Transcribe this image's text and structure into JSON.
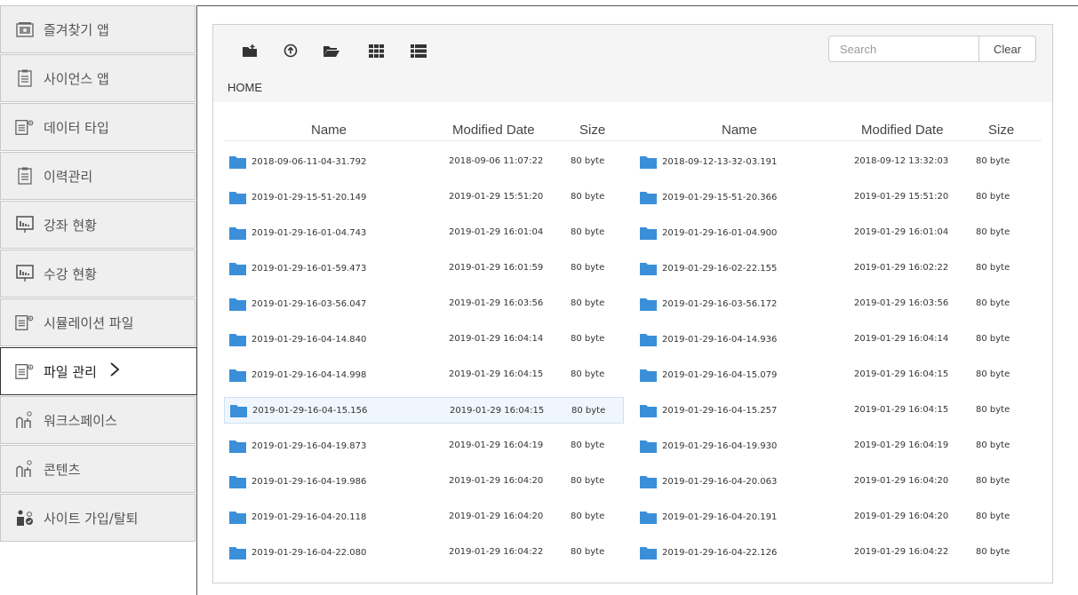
{
  "sidebar": {
    "items": [
      {
        "label": "즐겨찾기 앱",
        "icon": "favorites-app-icon"
      },
      {
        "label": "사이언스 앱",
        "icon": "document-icon"
      },
      {
        "label": "데이터 타입",
        "icon": "document-gear-icon"
      },
      {
        "label": "이력관리",
        "icon": "document-icon"
      },
      {
        "label": "강좌 현황",
        "icon": "bar-chart-icon"
      },
      {
        "label": "수강 현황",
        "icon": "bar-chart-icon"
      },
      {
        "label": "시뮬레이션 파일",
        "icon": "document-gear-icon"
      },
      {
        "label": "파일 관리",
        "icon": "document-gear-icon",
        "active": true
      },
      {
        "label": "워크스페이스",
        "icon": "workspace-icon"
      },
      {
        "label": "콘텐츠",
        "icon": "workspace-icon"
      },
      {
        "label": "사이트 가입/탈퇴",
        "icon": "user-settings-icon"
      }
    ]
  },
  "toolbar": {
    "buttons": [
      "new-folder-icon",
      "upload-icon",
      "open-folder-icon",
      "grid-view-icon",
      "list-view-icon"
    ],
    "search_placeholder": "Search",
    "clear_label": "Clear"
  },
  "breadcrumb": "HOME",
  "columns": {
    "name": "Name",
    "modified": "Modified Date",
    "size": "Size"
  },
  "files": [
    {
      "name": "2018-09-06-11-04-31.792",
      "modified": "2018-09-06 11:07:22",
      "size": "80 byte"
    },
    {
      "name": "2018-09-12-13-32-03.191",
      "modified": "2018-09-12 13:32:03",
      "size": "80 byte"
    },
    {
      "name": "2019-01-29-15-51-20.149",
      "modified": "2019-01-29 15:51:20",
      "size": "80 byte"
    },
    {
      "name": "2019-01-29-15-51-20.366",
      "modified": "2019-01-29 15:51:20",
      "size": "80 byte"
    },
    {
      "name": "2019-01-29-16-01-04.743",
      "modified": "2019-01-29 16:01:04",
      "size": "80 byte"
    },
    {
      "name": "2019-01-29-16-01-04.900",
      "modified": "2019-01-29 16:01:04",
      "size": "80 byte"
    },
    {
      "name": "2019-01-29-16-01-59.473",
      "modified": "2019-01-29 16:01:59",
      "size": "80 byte"
    },
    {
      "name": "2019-01-29-16-02-22.155",
      "modified": "2019-01-29 16:02:22",
      "size": "80 byte"
    },
    {
      "name": "2019-01-29-16-03-56.047",
      "modified": "2019-01-29 16:03:56",
      "size": "80 byte"
    },
    {
      "name": "2019-01-29-16-03-56.172",
      "modified": "2019-01-29 16:03:56",
      "size": "80 byte"
    },
    {
      "name": "2019-01-29-16-04-14.840",
      "modified": "2019-01-29 16:04:14",
      "size": "80 byte"
    },
    {
      "name": "2019-01-29-16-04-14.936",
      "modified": "2019-01-29 16:04:14",
      "size": "80 byte"
    },
    {
      "name": "2019-01-29-16-04-14.998",
      "modified": "2019-01-29 16:04:15",
      "size": "80 byte"
    },
    {
      "name": "2019-01-29-16-04-15.079",
      "modified": "2019-01-29 16:04:15",
      "size": "80 byte"
    },
    {
      "name": "2019-01-29-16-04-15.156",
      "modified": "2019-01-29 16:04:15",
      "size": "80 byte",
      "selected": true
    },
    {
      "name": "2019-01-29-16-04-15.257",
      "modified": "2019-01-29 16:04:15",
      "size": "80 byte"
    },
    {
      "name": "2019-01-29-16-04-19.873",
      "modified": "2019-01-29 16:04:19",
      "size": "80 byte"
    },
    {
      "name": "2019-01-29-16-04-19.930",
      "modified": "2019-01-29 16:04:19",
      "size": "80 byte"
    },
    {
      "name": "2019-01-29-16-04-19.986",
      "modified": "2019-01-29 16:04:20",
      "size": "80 byte"
    },
    {
      "name": "2019-01-29-16-04-20.063",
      "modified": "2019-01-29 16:04:20",
      "size": "80 byte"
    },
    {
      "name": "2019-01-29-16-04-20.118",
      "modified": "2019-01-29 16:04:20",
      "size": "80 byte"
    },
    {
      "name": "2019-01-29-16-04-20.191",
      "modified": "2019-01-29 16:04:20",
      "size": "80 byte"
    },
    {
      "name": "2019-01-29-16-04-22.080",
      "modified": "2019-01-29 16:04:22",
      "size": "80 byte"
    },
    {
      "name": "2019-01-29-16-04-22.126",
      "modified": "2019-01-29 16:04:22",
      "size": "80 byte"
    }
  ],
  "colors": {
    "folder": "#3b8fd9",
    "selected_bg": "#f0f6fd",
    "sidebar_bg": "#efefef"
  }
}
